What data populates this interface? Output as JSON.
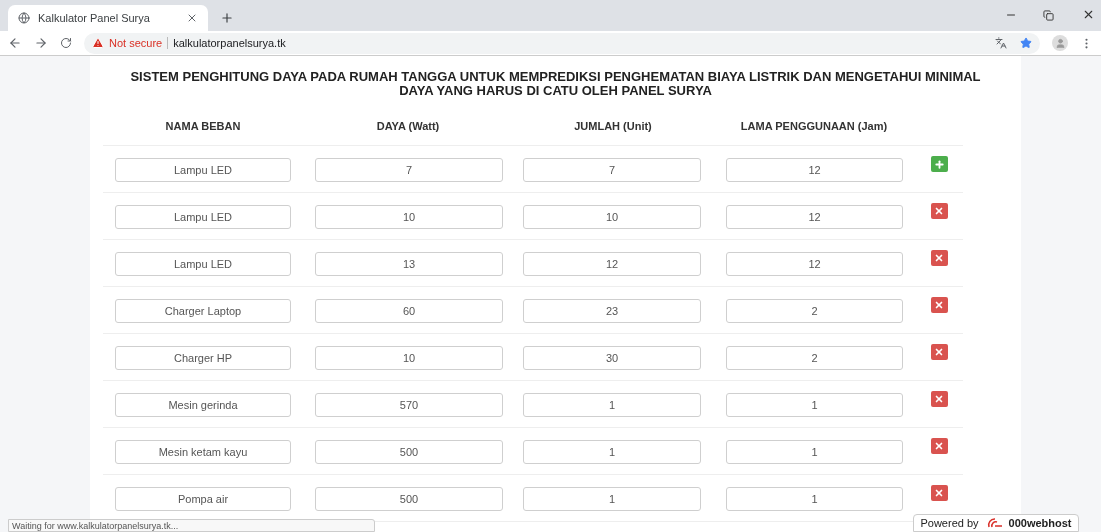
{
  "browser": {
    "tab_title": "Kalkulator Panel Surya",
    "security": "Not secure",
    "url": "kalkulatorpanelsurya.tk",
    "status": "Waiting for www.kalkulatorpanelsurya.tk..."
  },
  "page": {
    "title": "SISTEM PENGHITUNG DAYA PADA RUMAH TANGGA UNTUK MEMPREDIKSI PENGHEMATAN BIAYA LISTRIK DAN MENGETAHUI MINIMAL DAYA YANG HARUS DI CATU OLEH PANEL SURYA",
    "columns": [
      "NAMA BEBAN",
      "DAYA (Watt)",
      "JUMLAH (Unit)",
      "LAMA PENGGUNAAN (Jam)"
    ],
    "rows": [
      {
        "name": "Lampu LED",
        "daya": "7",
        "jumlah": "7",
        "lama": "12",
        "kind": "add"
      },
      {
        "name": "Lampu LED",
        "daya": "10",
        "jumlah": "10",
        "lama": "12",
        "kind": "remove"
      },
      {
        "name": "Lampu LED",
        "daya": "13",
        "jumlah": "12",
        "lama": "12",
        "kind": "remove"
      },
      {
        "name": "Charger Laptop",
        "daya": "60",
        "jumlah": "23",
        "lama": "2",
        "kind": "remove"
      },
      {
        "name": "Charger HP",
        "daya": "10",
        "jumlah": "30",
        "lama": "2",
        "kind": "remove"
      },
      {
        "name": "Mesin gerinda",
        "daya": "570",
        "jumlah": "1",
        "lama": "1",
        "kind": "remove"
      },
      {
        "name": "Mesin ketam kayu",
        "daya": "500",
        "jumlah": "1",
        "lama": "1",
        "kind": "remove"
      },
      {
        "name": "Pompa air",
        "daya": "500",
        "jumlah": "1",
        "lama": "1",
        "kind": "remove"
      }
    ]
  },
  "host_badge": {
    "prefix": "Powered by",
    "brand": "000webhost"
  }
}
